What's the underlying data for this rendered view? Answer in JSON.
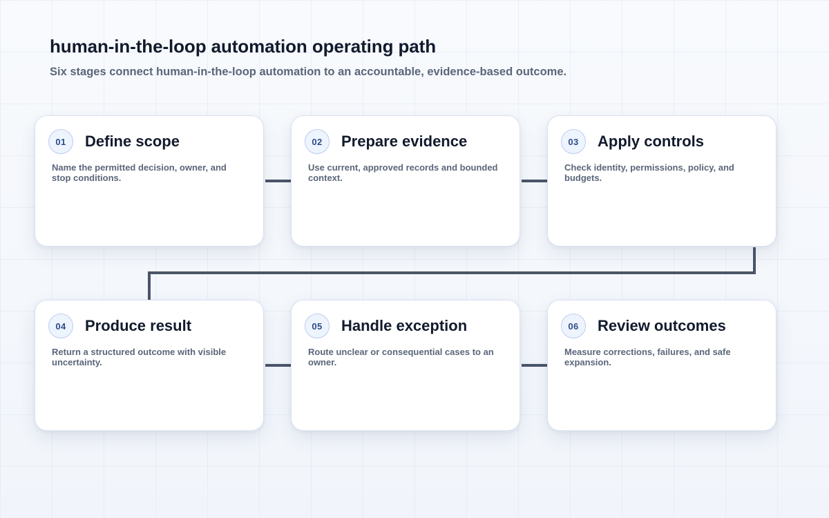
{
  "header": {
    "title": "human-in-the-loop automation operating path",
    "subtitle": "Six stages connect human-in-the-loop automation to an accountable, evidence-based outcome."
  },
  "stages": [
    {
      "number": "01",
      "title": "Define scope",
      "description": "Name the permitted decision, owner, and stop conditions."
    },
    {
      "number": "02",
      "title": "Prepare evidence",
      "description": "Use current, approved records and bounded context."
    },
    {
      "number": "03",
      "title": "Apply controls",
      "description": "Check identity, permissions, policy, and budgets."
    },
    {
      "number": "04",
      "title": "Produce result",
      "description": "Return a structured outcome with visible uncertainty."
    },
    {
      "number": "05",
      "title": "Handle exception",
      "description": "Route unclear or consequential cases to an owner."
    },
    {
      "number": "06",
      "title": "Review outcomes",
      "description": "Measure corrections, failures, and safe expansion."
    }
  ],
  "colors": {
    "connector": "#4a5568",
    "badge_text": "#2c4c8a",
    "title_text": "#121a2c",
    "body_text": "#5a6679"
  }
}
